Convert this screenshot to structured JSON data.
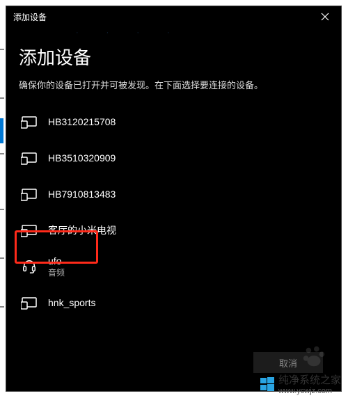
{
  "titlebar": {
    "title": "添加设备"
  },
  "heading": "添加设备",
  "subtext": "确保你的设备已打开并可被发现。在下面选择要连接的设备。",
  "devices": [
    {
      "name": "HB3120215708",
      "sub": "",
      "icon": "display",
      "highlighted": false
    },
    {
      "name": "HB3510320909",
      "sub": "",
      "icon": "display",
      "highlighted": false
    },
    {
      "name": "HB7910813483",
      "sub": "",
      "icon": "display",
      "highlighted": false
    },
    {
      "name": "客厅的小米电视",
      "sub": "",
      "icon": "display",
      "highlighted": false
    },
    {
      "name": "ufo",
      "sub": "音频",
      "icon": "headset",
      "highlighted": true
    },
    {
      "name": "hnk_sports",
      "sub": "",
      "icon": "display",
      "highlighted": false
    }
  ],
  "bottom_button": "取消",
  "watermark": {
    "brand": "纯净系统之家",
    "url": "www.ycwjz.com"
  }
}
